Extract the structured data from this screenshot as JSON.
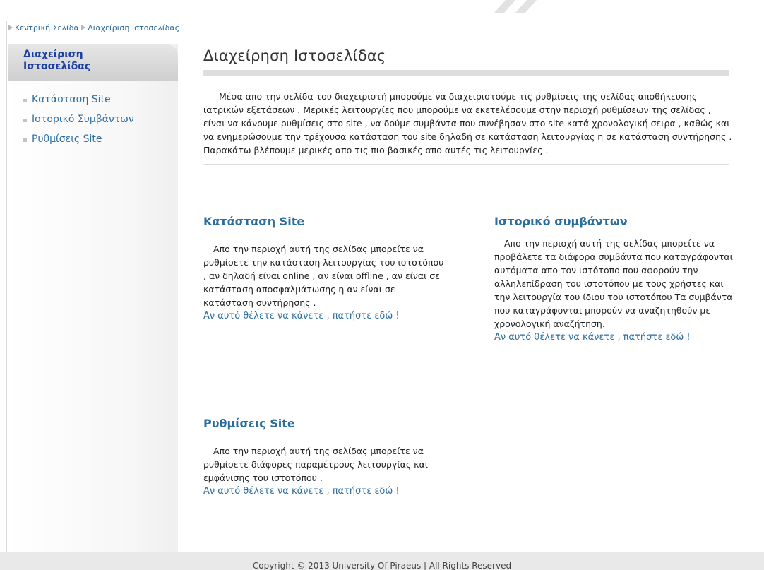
{
  "breadcrumb": {
    "home": "Κεντρική Σελίδα",
    "current": "Διαχείριση Ιστοσελίδας"
  },
  "sidebar": {
    "header": "Διαχείριση Ιστοσελίδας",
    "items": [
      {
        "label": "Κατάσταση Site"
      },
      {
        "label": "Ιστορικό Συμβάντων"
      },
      {
        "label": "Ρυθμίσεις Site"
      }
    ]
  },
  "main": {
    "title": "Διαχείρηση Ιστοσελίδας",
    "intro": "Μέσα απο την σελίδα του διαχειριστή μπορούμε να διαχειριστούμε τις ρυθμίσεις της σελίδας αποθήκευσης ιατρικών εξετάσεων . Μερικές λειτουργίες που μπορούμε να εκετελέσουμε στην περιοχή ρυθμίσεων της σελίδας , είναι να κάνουμε ρυθμίσεις στο site , να δούμε συμβάντα που συνέβησαν στο site κατά χρονολογική σειρα , καθώς και να ενημερώσουμε την τρέχουσα κατάσταση του site δηλαδή σε κατάσταση λειτουργίας η σε κατάσταση συντήρησης . Παρακάτω βλέπουμε μερικές απο τις πιο βασικές απο αυτές τις λειτουργίες .",
    "sections": {
      "status": {
        "title": "Κατάσταση Site",
        "text": "Απο την περιοχή αυτή της σελίδας μπορείτε να ρυθμίσετε την κατάσταση λειτουργίας του ιστοτόπου , αν δηλαδή είναι online , αν είναι offline , αν είναι σε κατάσταση αποσφαλμάτωσης η αν είναι σε κατάσταση συντήρησης .",
        "link": "Αν αυτό θέλετε να κάνετε , πατήστε εδώ !"
      },
      "history": {
        "title": "Ιστορικό συμβάντων",
        "text": "Απο την περιοχή αυτή της σελίδας μπορείτε να προβάλετε τα διάφορα συμβάντα που καταγράφονται αυτόματα απο τον ιστότοπο που αφορούν την αλληλεπίδραση του ιστοτόπου με τους χρήστες και την λειτουργία του ίδιου του ιστοτόπου Τα συμβάντα που καταγράφονται μπορούν να αναζητηθούν με χρονολογική αναζήτηση.",
        "link": "Αν αυτό θέλετε να κάνετε , πατήστε εδώ !"
      },
      "settings": {
        "title": "Ρυθμίσεις Site",
        "text": "Απο την περιοχή αυτή της σελίδας μπορείτε να ρυθμίσετε διάφορες παραμέτρους λειτουργίας και εμφάνισης του ιστοτόπου .",
        "link": "Αν αυτό θέλετε να κάνετε , πατήστε εδώ !"
      }
    }
  },
  "footer": {
    "text": "Copyright © 2013 University Of Piraeus | All Rights Reserved"
  },
  "colors": {
    "link": "#2b6d9c",
    "sidebar_header": "#1a3fa0",
    "rule": "#dedede"
  }
}
